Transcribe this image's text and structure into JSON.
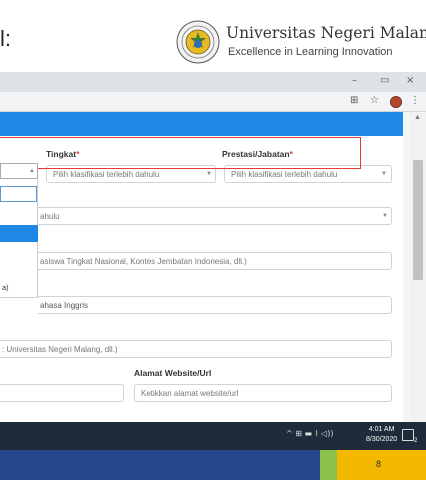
{
  "slide": {
    "title": "l:",
    "university_name": "Universitas Negeri Malang",
    "tagline": "Excellence in Learning Innovation",
    "page_number": "8"
  },
  "window_controls": {
    "minimize": "–",
    "maximize": "▭",
    "close": "×"
  },
  "browser_toolbar": {
    "translate": "⊞",
    "star": "☆",
    "menu": "⋮"
  },
  "form": {
    "tingkat": {
      "label": "Tingkat",
      "required": "*",
      "value": "Pilih klasifikasi terlebih dahulu"
    },
    "prestasi": {
      "label": "Prestasi/Jabatan",
      "required": "*",
      "value": "Pilih klasifikasi terlebih dahulu"
    },
    "row2_value": "ahulu",
    "event_placeholder": "asiswa Tingkat Nasional, Kontes Jembatan Indonesia, dll.)",
    "row4_value": "ahasa Inggris",
    "organizer_placeholder": ": Universitas Negeri Malang, dll.)",
    "website": {
      "label": "Alamat Website/Url",
      "placeholder": "Ketikkan alamat website/url"
    },
    "dropdown_fragment": "a)"
  },
  "taskbar": {
    "time": "4:01 AM",
    "date": "8/30/2020",
    "tray_icons": "^ ⊞ ▬ ⌇ ◁))",
    "notification_count": "2"
  },
  "colors": {
    "accent_blue": "#1e88e5",
    "required_red": "#e53935",
    "footer_blue": "#27478c",
    "footer_green": "#8bc34a",
    "footer_yellow": "#f5b800"
  }
}
